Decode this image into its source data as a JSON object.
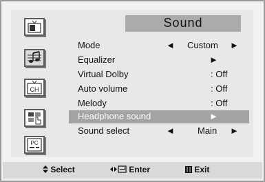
{
  "header": {
    "title": "Sound"
  },
  "sidebar": [
    {
      "name": "picture-icon"
    },
    {
      "name": "sound-icon"
    },
    {
      "name": "channel-icon",
      "label": "CH"
    },
    {
      "name": "setup-icon"
    },
    {
      "name": "pc-icon",
      "label": "PC"
    }
  ],
  "menu": [
    {
      "label": "Mode",
      "left": "◄",
      "value": "Custom",
      "right": "►"
    },
    {
      "label": "Equalizer",
      "right": "►"
    },
    {
      "label": "Virtual Dolby",
      "value": ": Off"
    },
    {
      "label": "Auto volume",
      "value": ": Off"
    },
    {
      "label": "Melody",
      "value": ": Off"
    },
    {
      "label": "Headphone sound",
      "right": "►",
      "selected": true
    },
    {
      "label": "Sound select",
      "left": "◄",
      "value": "Main",
      "right": "►"
    }
  ],
  "footer": {
    "select": "Select",
    "enter": "Enter",
    "exit": "Exit",
    "select_icon": "updown-icon",
    "enter_icon": "enter-icon",
    "exit_icon": "menu-icon"
  }
}
